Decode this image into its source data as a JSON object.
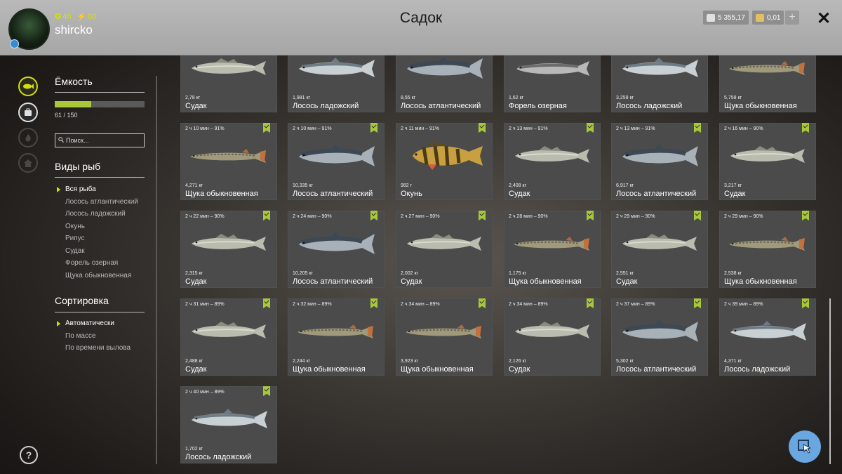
{
  "header": {
    "title": "Садок",
    "username": "shircko",
    "stat_a": "40",
    "stat_b": "60",
    "money": "5 355,17",
    "gold": "0,01",
    "plus_label": "+",
    "close_label": "✕"
  },
  "sidebar": {
    "capacity_title": "Ёмкость",
    "capacity_text": "61 / 150",
    "capacity_fraction": 0.407,
    "search_placeholder": "Поиск...",
    "species_title": "Виды рыб",
    "species": [
      "Вся рыба",
      "Лосось атлантический",
      "Лосось ладожский",
      "Окунь",
      "Рипус",
      "Судак",
      "Форель озерная",
      "Щука обыкновенная"
    ],
    "species_active": 0,
    "sort_title": "Сортировка",
    "sort": [
      "Автоматически",
      "По массе",
      "По времени вылова"
    ],
    "sort_active": 0,
    "help_label": "?"
  },
  "colors": {
    "accent": "#a8c83a",
    "header": "#b0b0b0",
    "card": "#4b4b4b"
  },
  "cards": [
    {
      "meta": "",
      "weight": "2,78 кг",
      "name": "Судак",
      "kind": "zander"
    },
    {
      "meta": "",
      "weight": "1,981 кг",
      "name": "Лосось ладожский",
      "kind": "salmon"
    },
    {
      "meta": "",
      "weight": "8,55 кг",
      "name": "Лосось атлантический",
      "kind": "salmon_dark"
    },
    {
      "meta": "",
      "weight": "1,62 кг",
      "name": "Форель озерная",
      "kind": "trout"
    },
    {
      "meta": "",
      "weight": "3,259 кг",
      "name": "Лосось ладожский",
      "kind": "salmon"
    },
    {
      "meta": "",
      "weight": "5,758 кг",
      "name": "Щука обыкновенная",
      "kind": "pike"
    },
    {
      "meta": "2 ч 10 мин – 91%",
      "weight": "4,271 кг",
      "name": "Щука обыкновенная",
      "kind": "pike"
    },
    {
      "meta": "2 ч 10 мин – 91%",
      "weight": "10,335 кг",
      "name": "Лосось атлантический",
      "kind": "salmon_dark"
    },
    {
      "meta": "2 ч 11 мин – 91%",
      "weight": "982 г",
      "name": "Окунь",
      "kind": "perch"
    },
    {
      "meta": "2 ч 13 мин – 91%",
      "weight": "2,408 кг",
      "name": "Судак",
      "kind": "zander"
    },
    {
      "meta": "2 ч 13 мин – 91%",
      "weight": "6,917 кг",
      "name": "Лосось атлантический",
      "kind": "salmon_dark"
    },
    {
      "meta": "2 ч 16 мин – 90%",
      "weight": "3,217 кг",
      "name": "Судак",
      "kind": "zander"
    },
    {
      "meta": "2 ч 22 мин – 90%",
      "weight": "2,315 кг",
      "name": "Судак",
      "kind": "zander"
    },
    {
      "meta": "2 ч 24 мин – 90%",
      "weight": "10,205 кг",
      "name": "Лосось атлантический",
      "kind": "salmon_dark"
    },
    {
      "meta": "2 ч 27 мин – 90%",
      "weight": "2,002 кг",
      "name": "Судак",
      "kind": "zander"
    },
    {
      "meta": "2 ч 28 мин – 90%",
      "weight": "1,175 кг",
      "name": "Щука обыкновенная",
      "kind": "pike"
    },
    {
      "meta": "2 ч 29 мин – 90%",
      "weight": "2,551 кг",
      "name": "Судак",
      "kind": "zander"
    },
    {
      "meta": "2 ч 29 мин – 90%",
      "weight": "2,538 кг",
      "name": "Щука обыкновенная",
      "kind": "pike"
    },
    {
      "meta": "2 ч 31 мин – 89%",
      "weight": "2,488 кг",
      "name": "Судак",
      "kind": "zander"
    },
    {
      "meta": "2 ч 32 мин – 89%",
      "weight": "2,244 кг",
      "name": "Щука обыкновенная",
      "kind": "pike"
    },
    {
      "meta": "2 ч 34 мин – 89%",
      "weight": "3,923 кг",
      "name": "Щука обыкновенная",
      "kind": "pike"
    },
    {
      "meta": "2 ч 34 мин – 89%",
      "weight": "2,126 кг",
      "name": "Судак",
      "kind": "zander"
    },
    {
      "meta": "2 ч 37 мин – 89%",
      "weight": "5,302 кг",
      "name": "Лосось атлантический",
      "kind": "salmon_dark"
    },
    {
      "meta": "2 ч 39 мин – 89%",
      "weight": "4,371 кг",
      "name": "Лосось ладожский",
      "kind": "salmon"
    },
    {
      "meta": "2 ч 40 мин – 89%",
      "weight": "1,702 кг",
      "name": "Лосось ладожский",
      "kind": "salmon"
    }
  ]
}
